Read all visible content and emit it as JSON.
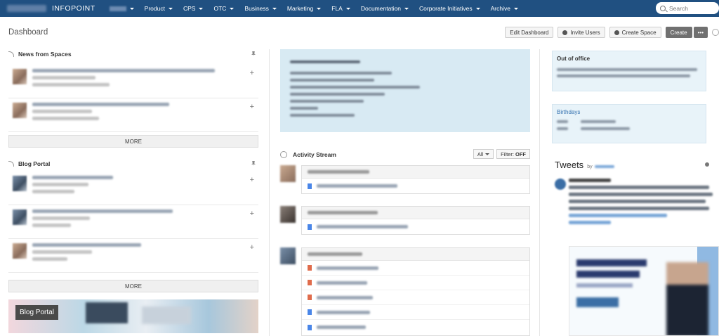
{
  "topbar": {
    "brand": "INFOPOINT",
    "nav": [
      "Product",
      "CPS",
      "OTC",
      "Business",
      "Marketing",
      "FLA",
      "Documentation",
      "Corporate Initiatives",
      "Archive"
    ],
    "search_placeholder": "Search"
  },
  "page": {
    "title": "Dashboard",
    "actions": {
      "edit": "Edit Dashboard",
      "invite": "Invite Users",
      "create_space": "Create Space",
      "create": "Create",
      "more": "•••"
    }
  },
  "news": {
    "title": "News from Spaces",
    "more": "MORE"
  },
  "blog": {
    "title": "Blog Portal",
    "more": "MORE",
    "banner_label": "Blog Portal"
  },
  "stream": {
    "title": "Activity Stream",
    "filter_all": "All",
    "filter_label": "Filter:",
    "filter_value": "OFF"
  },
  "sidebar": {
    "out_of_office": "Out of office",
    "birthdays": "Birthdays"
  },
  "tweets": {
    "title": "Tweets",
    "by": "by"
  },
  "colors": {
    "topbar": "#205081",
    "accent_blue": "#3572b0",
    "note_bg": "#d8eaf3"
  }
}
